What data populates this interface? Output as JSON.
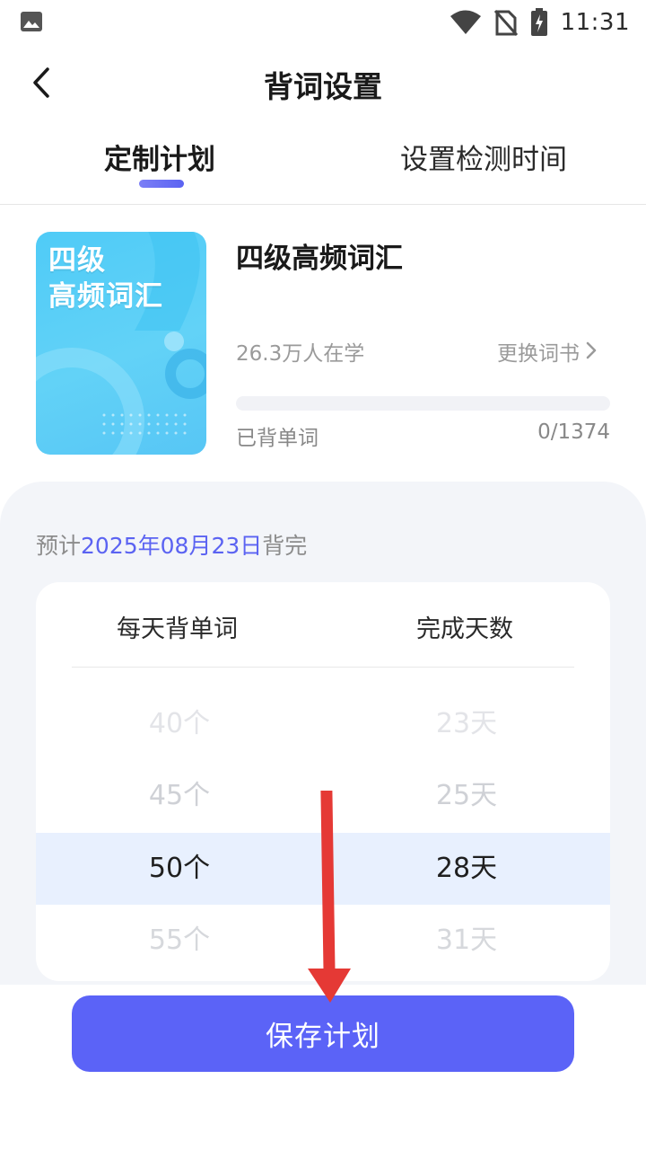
{
  "status_bar": {
    "time": "11:31",
    "icons": [
      "image-icon",
      "wifi-icon",
      "no-sim-icon",
      "battery-charging-icon"
    ]
  },
  "header": {
    "title": "背词设置",
    "back_icon": "chevron-left-icon"
  },
  "tabs": [
    {
      "label": "定制计划",
      "active": true
    },
    {
      "label": "设置检测时间",
      "active": false
    }
  ],
  "book": {
    "cover_text_line1": "四级",
    "cover_text_line2": "高频词汇",
    "name": "四级高频词汇",
    "learners": "26.3万人在学",
    "change_label": "更换词书",
    "progress_fraction": 0,
    "learned_label": "已背单词",
    "learned_count": "0/1374"
  },
  "plan": {
    "forecast_prefix": "预计",
    "forecast_date": "2025年08月23日",
    "forecast_suffix": "背完",
    "col_words": "每天背单词",
    "col_days": "完成天数",
    "rows": [
      {
        "words": "40个",
        "days": "23天"
      },
      {
        "words": "45个",
        "days": "25天"
      },
      {
        "words": "50个",
        "days": "28天",
        "selected": true
      },
      {
        "words": "55个",
        "days": "31天"
      }
    ]
  },
  "save_button": "保存计划",
  "colors": {
    "accent": "#5b63f7",
    "selected_row": "#e8f0fe",
    "panel_bg": "#f3f5f9",
    "annotation_arrow": "#e53935"
  }
}
